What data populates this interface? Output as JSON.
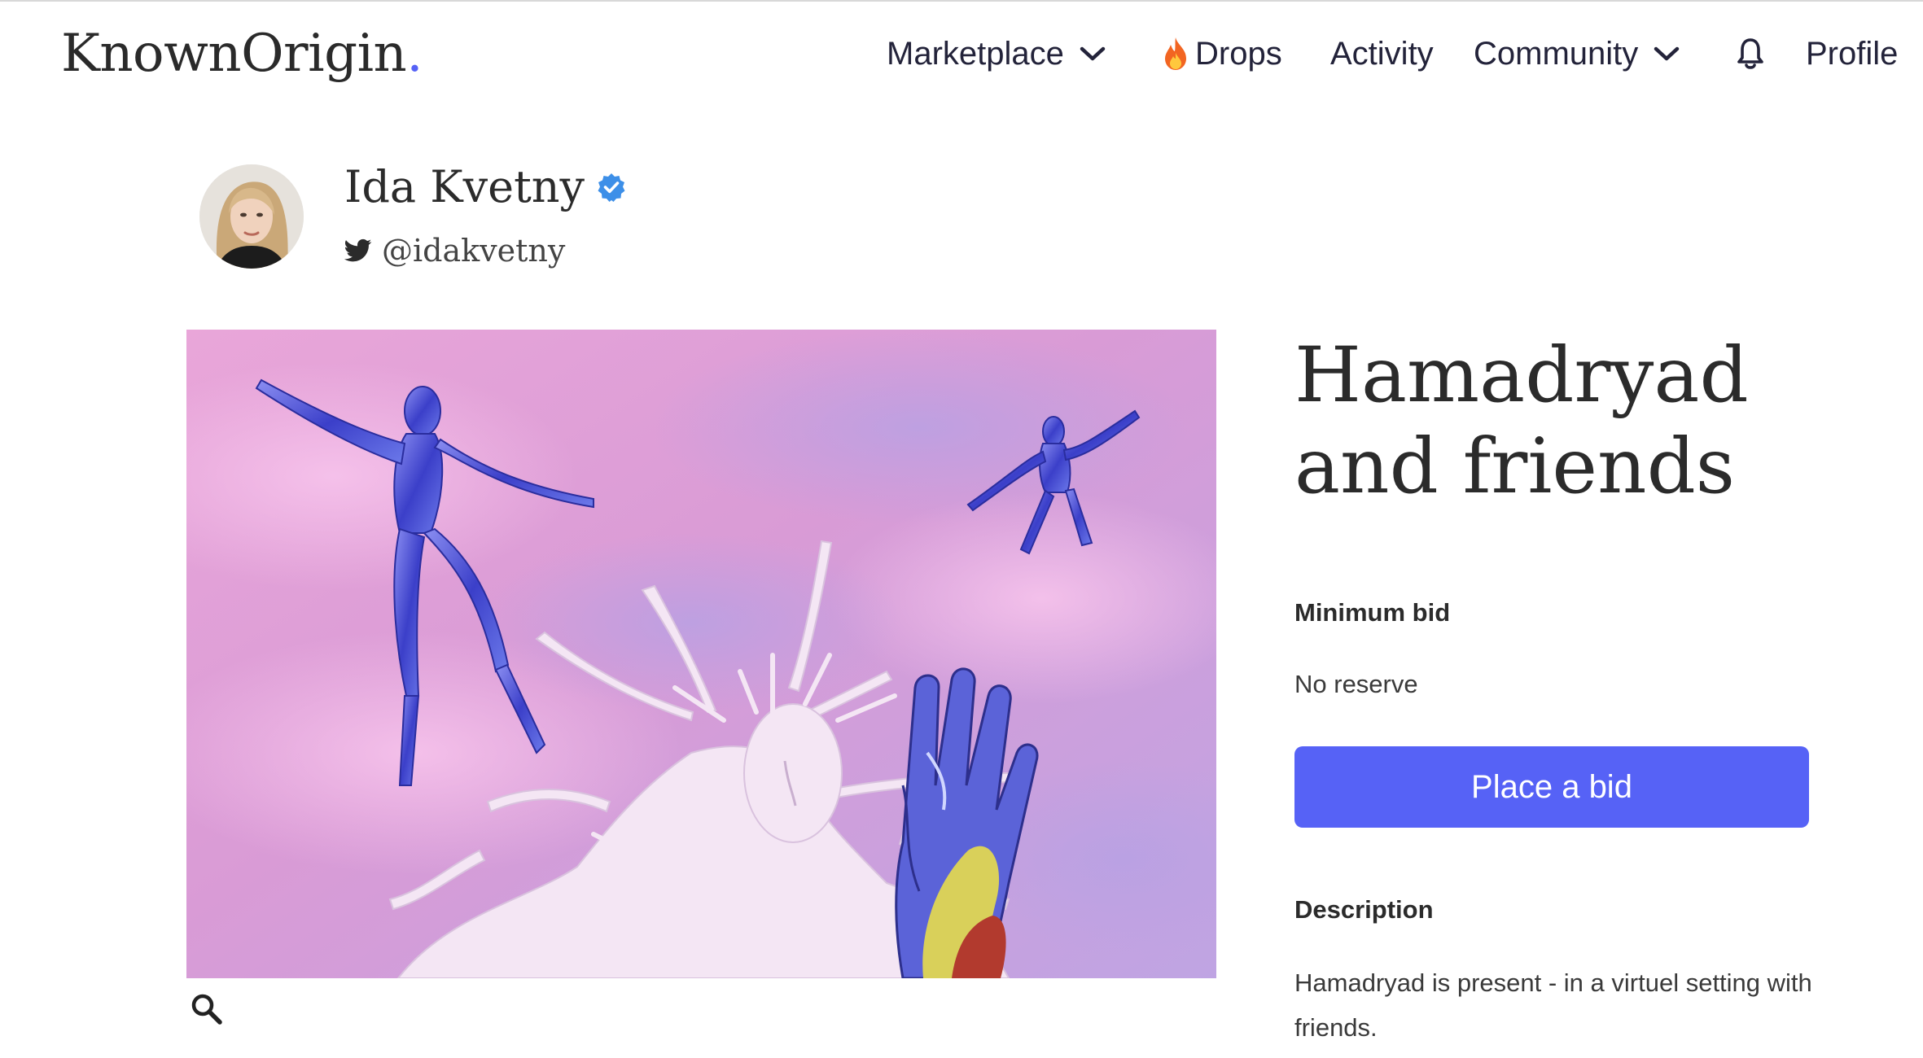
{
  "brand": {
    "logo_text": "KnownOrigin",
    "logo_dot": ".",
    "accent": "#5662f6"
  },
  "nav": {
    "marketplace": "Marketplace",
    "drops": "Drops",
    "activity": "Activity",
    "community": "Community",
    "profile": "Profile",
    "icons": {
      "marketplace": "chevron-down-icon",
      "drops": "fire-icon",
      "community": "chevron-down-icon",
      "notifications": "bell-icon"
    }
  },
  "artist": {
    "name": "Ida Kvetny",
    "handle": "@idakvetny",
    "verified_icon": "verified-badge-icon",
    "social_icon": "twitter-icon",
    "badge_color": "#3d8fe8"
  },
  "artwork": {
    "title_line1": "Hamadryad",
    "title_line2": "and friends",
    "zoom_icon": "search-icon"
  },
  "details": {
    "min_bid_label": "Minimum bid",
    "min_bid_value": "No reserve",
    "bid_button": "Place a bid",
    "description_label": "Description",
    "description_text": "Hamadryad is present - in a virtuel setting with friends."
  }
}
